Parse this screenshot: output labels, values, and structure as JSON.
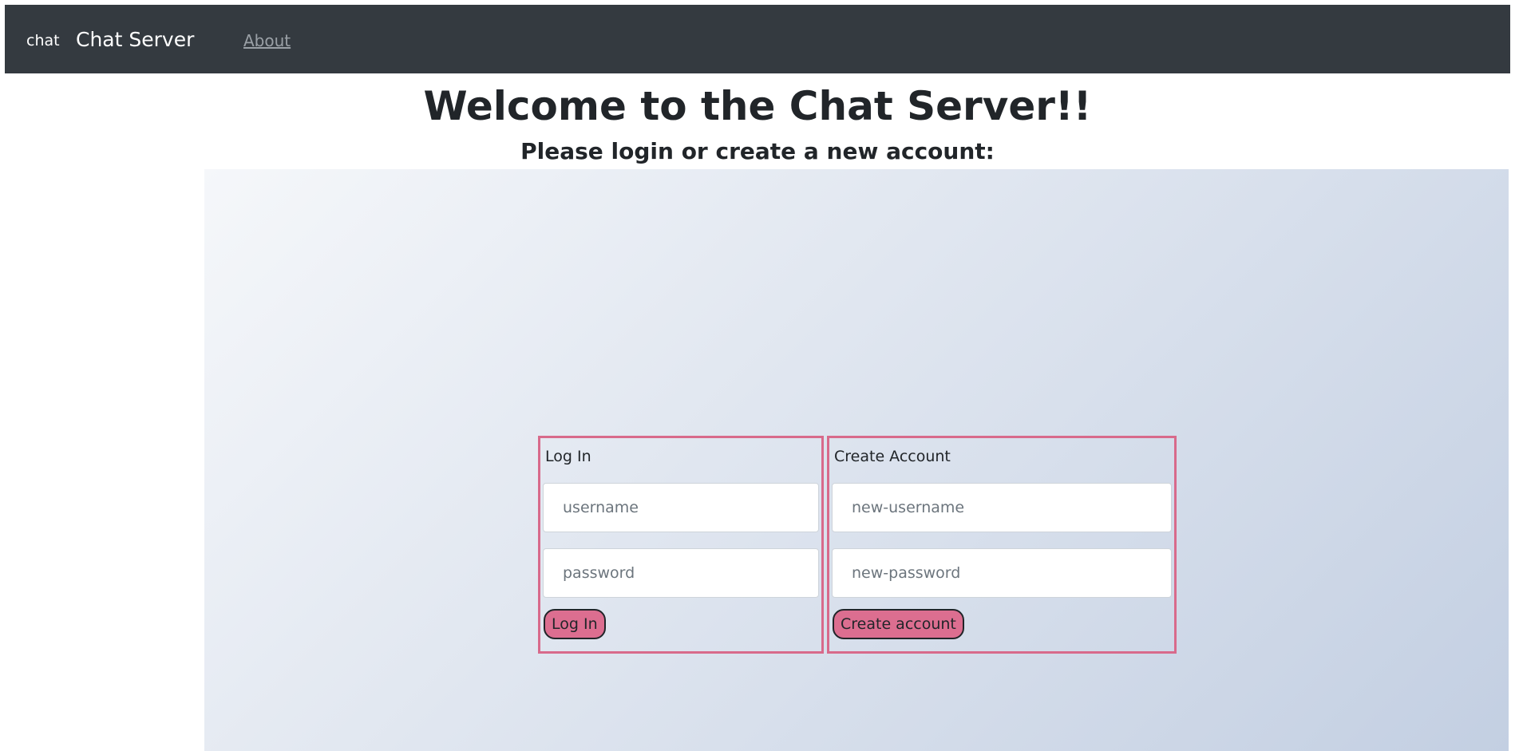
{
  "navbar": {
    "logo_text": "chat",
    "brand": "Chat Server",
    "about_link": "About"
  },
  "header": {
    "title": "Welcome to the Chat Server!!",
    "subtitle": "Please login or create a new account:"
  },
  "login": {
    "title": "Log In",
    "username_placeholder": "username",
    "password_placeholder": "password",
    "button_label": "Log In"
  },
  "create": {
    "title": "Create Account",
    "username_placeholder": "new-username",
    "password_placeholder": "new-password",
    "button_label": "Create account"
  },
  "colors": {
    "navbar_bg": "#343a40",
    "accent": "#dc6e90",
    "panel_border": "#d86a8b",
    "gradient_start": "#f5f7fa",
    "gradient_end": "#c3cfe2"
  }
}
